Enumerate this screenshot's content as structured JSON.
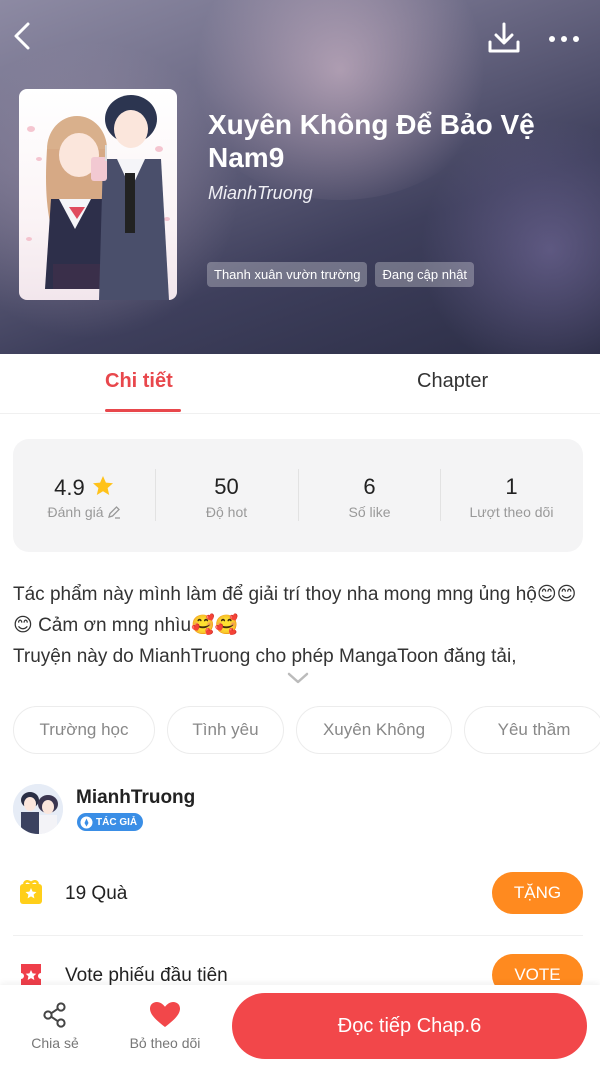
{
  "colors": {
    "accent": "#e8474c",
    "orange": "#ff8a1f",
    "read_button": "#f2474a",
    "badge_blue": "#3a8ee6"
  },
  "header": {
    "icons": [
      "back-icon",
      "download-icon",
      "more-icon"
    ],
    "title": "Xuyên Không Để Bảo Vệ Nam9",
    "author": "MianhTruong",
    "tags": [
      "Thanh xuân vườn trường",
      "Đang cập nhật"
    ]
  },
  "tabs": {
    "detail": "Chi tiết",
    "chapter": "Chapter",
    "active": "Chi tiết"
  },
  "stats": [
    {
      "value": "4.9",
      "label": "Đánh giá"
    },
    {
      "value": "50",
      "label": "Độ hot"
    },
    {
      "value": "6",
      "label": "Số like"
    },
    {
      "value": "1",
      "label": "Lượt theo dõi"
    }
  ],
  "description": {
    "line1": "Tác phẩm này mình làm để giải trí thoy nha mong mng ủng hộ😊😊😊 Cảm ơn mng nhìu🥰🥰",
    "line2": "Truyện này do MianhTruong cho phép MangaToon đăng tải,"
  },
  "genres": [
    "Trường học",
    "Tình yêu",
    "Xuyên Không",
    "Yêu thầm"
  ],
  "author": {
    "name": "MianhTruong",
    "badge": "TÁC GIẢ"
  },
  "gift": {
    "text": "19 Quà",
    "button": "TẶNG"
  },
  "vote": {
    "text": "Vote phiếu đầu tiên",
    "button": "VOTE"
  },
  "bottom_bar": {
    "share_label": "Chia sẻ",
    "unfollow_label": "Bỏ theo dõi",
    "read_button": "Đọc tiếp Chap.6"
  }
}
